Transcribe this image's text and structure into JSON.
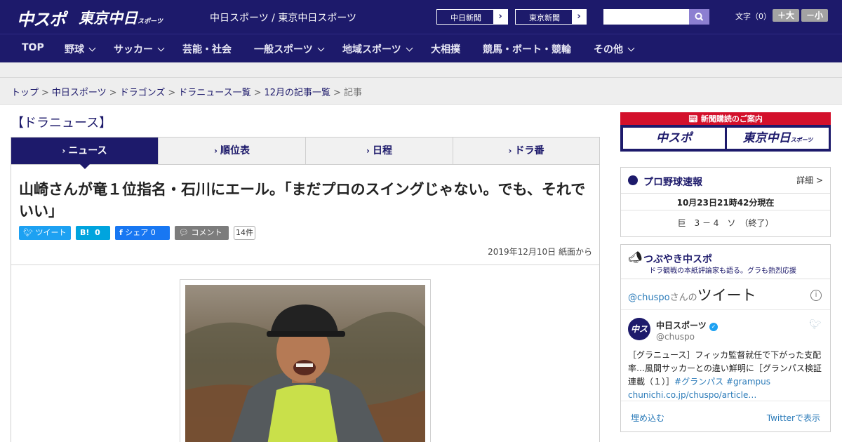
{
  "header": {
    "logo": "中スポ",
    "logo_tokyo": "東京中日",
    "logo_tokyo_sub": "スポーツ",
    "site_title": "中日スポーツ / 東京中日スポーツ",
    "ext_links": [
      "中日新聞",
      "東京新聞"
    ],
    "search_placeholder": "",
    "font_size_label": "文字（0）",
    "font_plus": "＋大",
    "font_minus": "－小"
  },
  "nav": [
    {
      "label": "TOP",
      "has_menu": false
    },
    {
      "label": "野球",
      "has_menu": true
    },
    {
      "label": "サッカー",
      "has_menu": true
    },
    {
      "label": "芸能・社会",
      "has_menu": false
    },
    {
      "label": "一般スポーツ",
      "has_menu": true
    },
    {
      "label": "地域スポーツ",
      "has_menu": true
    },
    {
      "label": "大相撲",
      "has_menu": false
    },
    {
      "label": "競馬・ボート・競輪",
      "has_menu": false
    },
    {
      "label": "その他",
      "has_menu": true
    }
  ],
  "breadcrumb": {
    "items": [
      "トップ",
      "中日スポーツ",
      "ドラゴンズ",
      "ドラニュース一覧",
      "12月の記事一覧"
    ],
    "current": "記事"
  },
  "section_title": "【ドラニュース】",
  "tabs": [
    "ニュース",
    "順位表",
    "日程",
    "ドラ番"
  ],
  "article": {
    "headline": "山崎さんが竜１位指名・石川にエール。「まだプロのスイングじゃない。でも、それでいい」",
    "share": {
      "tweet": "ツイート",
      "hatena_label": "B!",
      "hatena_count": "0",
      "fb_label": "シェア",
      "fb_count": "0",
      "comment": "コメント",
      "comment_count": "14件"
    },
    "dateline": "2019年12月10日 紙面から"
  },
  "sidebar": {
    "promo_title": "新聞購読のご案内",
    "promo_items": [
      "中スポ",
      "東京中日"
    ],
    "promo_sub": "スポーツ",
    "baseball": {
      "title": "プロ野球速報",
      "detail": "詳細 >",
      "timestamp": "10月23日21時42分現在",
      "score": "巨　3 － 4　ソ　（終了）"
    },
    "tweets": {
      "title": "つぶやき中スポ",
      "subtitle": "ドラ観戦の本紙評論家も語る。グラも熱烈応援",
      "handle_prefix": "@chuspo",
      "handle_suffix": "さんの",
      "heading": "ツイート",
      "account_name": "中日スポーツ",
      "account_handle": "@chuspo",
      "tweet_text": "［グラニュース］フィッカ監督就任で下がった支配率…風間サッカーとの違い鮮明に［グランパス検証連載（１）］",
      "hashtags": "#グランパス #grampus",
      "link": "chunichi.co.jp/chuspo/article…",
      "embed": "埋め込む",
      "view_on_twitter": "Twitterで表示"
    }
  },
  "colors": {
    "brand": "#1d1a6b",
    "promo_red": "#d3102b",
    "twitter": "#1da1f2",
    "hatena": "#00a4de",
    "facebook": "#1877f2"
  }
}
